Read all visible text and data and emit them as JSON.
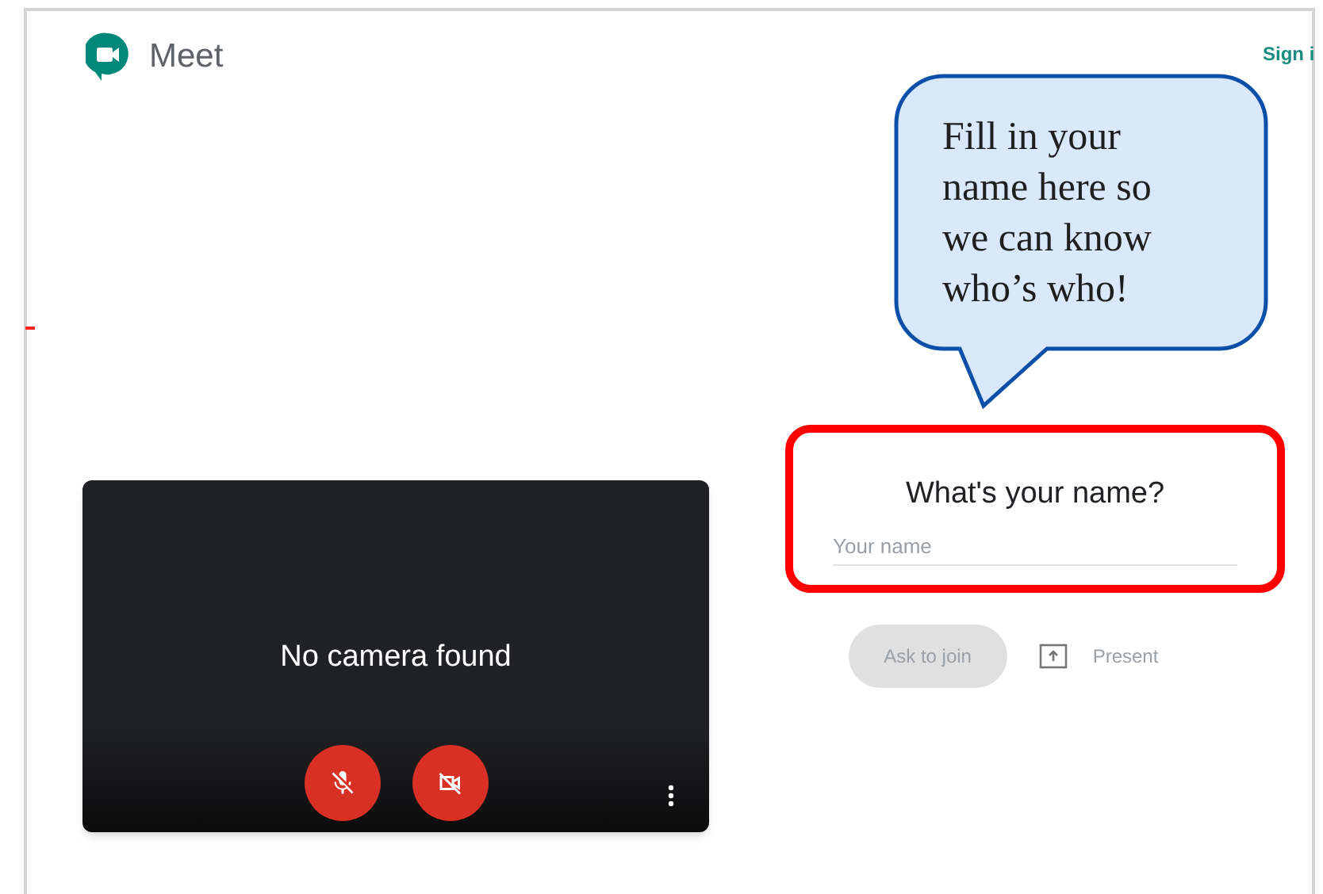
{
  "header": {
    "app_name": "Meet",
    "sign_in": "Sign i"
  },
  "preview": {
    "message": "No camera found",
    "controls": [
      {
        "kind": "mic",
        "on": false
      },
      {
        "kind": "camera",
        "on": false
      }
    ]
  },
  "join": {
    "title": "What's your name?",
    "name_field": {
      "placeholder": "Your name"
    },
    "ask_button": {
      "label": "Ask to join",
      "disabled": true
    },
    "present": {
      "label": "Present"
    }
  },
  "callout": {
    "text": "Fill in your name here so we can know who’s who!"
  }
}
